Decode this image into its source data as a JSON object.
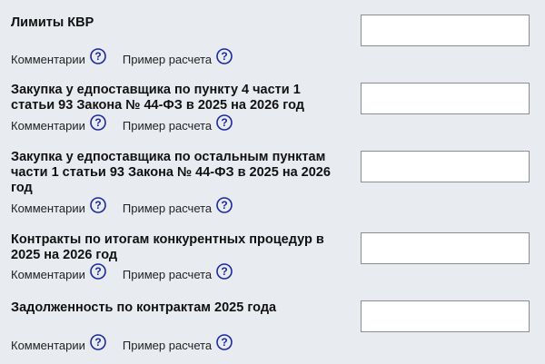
{
  "fields": [
    {
      "title": "Лимиты КВР",
      "comments_label": "Комментарии",
      "example_label": "Пример расчета",
      "value": ""
    },
    {
      "title": "Закупка у едпоставщика по пункту 4 части 1 статьи 93 Закона № 44-ФЗ в 2025 на 2026 год",
      "comments_label": "Комментарии",
      "example_label": "Пример расчета",
      "value": ""
    },
    {
      "title": "Закупка у едпоставщика по остальным пунктам части 1 статьи 93 Закона № 44-ФЗ в 2025 на 2026 год",
      "comments_label": "Комментарии",
      "example_label": "Пример расчета",
      "value": ""
    },
    {
      "title": "Контракты по итогам конкурентных процедур в 2025 на 2026 год",
      "comments_label": "Комментарии",
      "example_label": "Пример расчета",
      "value": ""
    },
    {
      "title": "Задолженность по контрактам 2025 года",
      "comments_label": "Комментарии",
      "example_label": "Пример расчета",
      "value": ""
    }
  ],
  "icons": {
    "help": "question-circle-icon",
    "help_color": "#1a2a9c"
  }
}
